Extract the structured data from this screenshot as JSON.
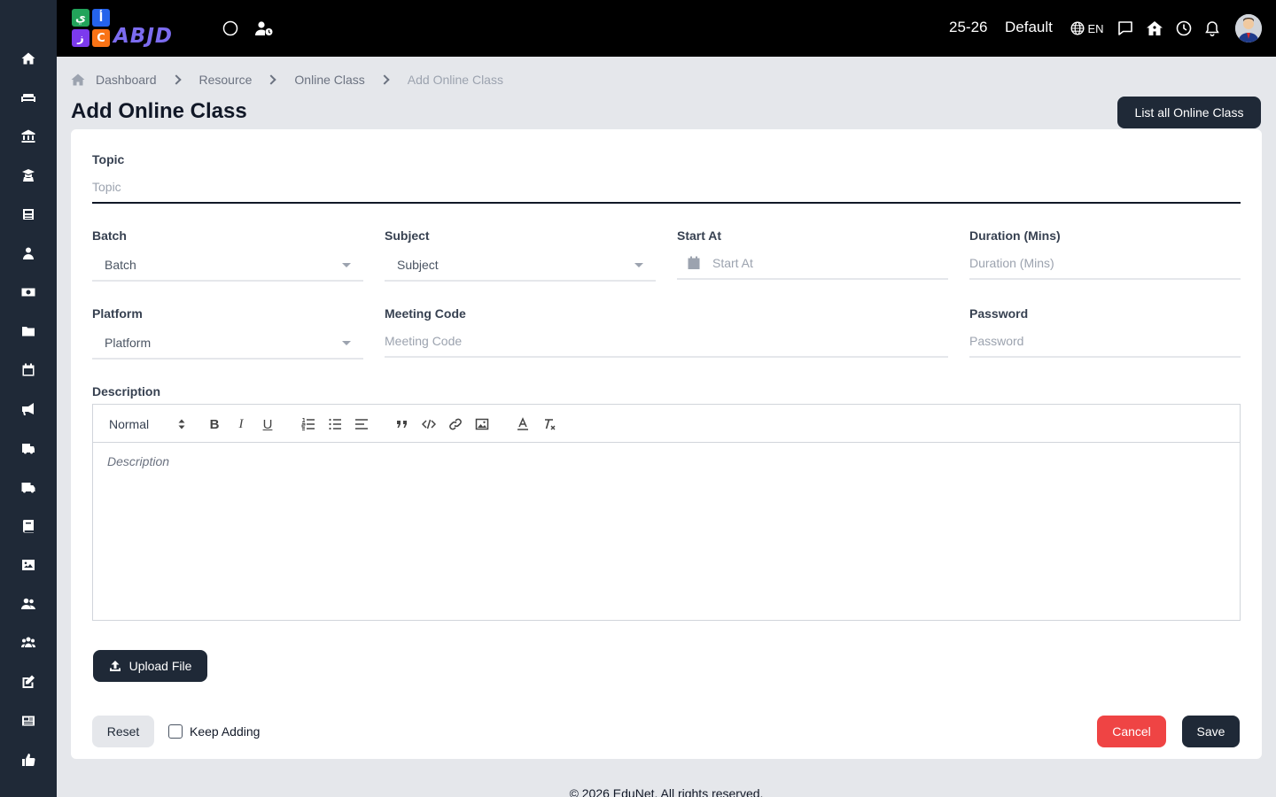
{
  "header": {
    "logo_tiles": [
      "ي",
      "أ",
      "ز",
      "C"
    ],
    "logo_text": "ABJD",
    "session": "25-26",
    "profile": "Default",
    "language": "EN"
  },
  "sidebar": {
    "items": [
      "home",
      "sofa",
      "bank",
      "teacher",
      "news",
      "user",
      "money",
      "folder",
      "calendar",
      "megaphone",
      "school-bus",
      "truck",
      "book",
      "image",
      "users",
      "user-group",
      "edit",
      "newspaper",
      "thumbs-up"
    ]
  },
  "breadcrumb": {
    "items": [
      "Dashboard",
      "Resource",
      "Online Class",
      "Add Online Class"
    ]
  },
  "page": {
    "title": "Add Online Class",
    "list_button": "List all Online Class"
  },
  "form": {
    "topic": {
      "label": "Topic",
      "placeholder": "Topic"
    },
    "batch": {
      "label": "Batch",
      "value": "Batch"
    },
    "subject": {
      "label": "Subject",
      "value": "Subject"
    },
    "start_at": {
      "label": "Start At",
      "placeholder": "Start At"
    },
    "duration": {
      "label": "Duration (Mins)",
      "placeholder": "Duration (Mins)"
    },
    "platform": {
      "label": "Platform",
      "value": "Platform"
    },
    "meeting_code": {
      "label": "Meeting Code",
      "placeholder": "Meeting Code"
    },
    "password": {
      "label": "Password",
      "placeholder": "Password"
    },
    "description": {
      "label": "Description",
      "placeholder": "Description",
      "format": "Normal"
    },
    "upload_label": "Upload File",
    "reset_label": "Reset",
    "keep_adding_label": "Keep Adding",
    "cancel_label": "Cancel",
    "save_label": "Save"
  },
  "colors": {
    "sidebar": "#1f2937",
    "topbar": "#000000",
    "primary_button": "#1f2937",
    "cancel": "#ef4444",
    "background": "#e5e7eb"
  },
  "footer": {
    "text": "© 2026 EduNet. All rights reserved."
  }
}
